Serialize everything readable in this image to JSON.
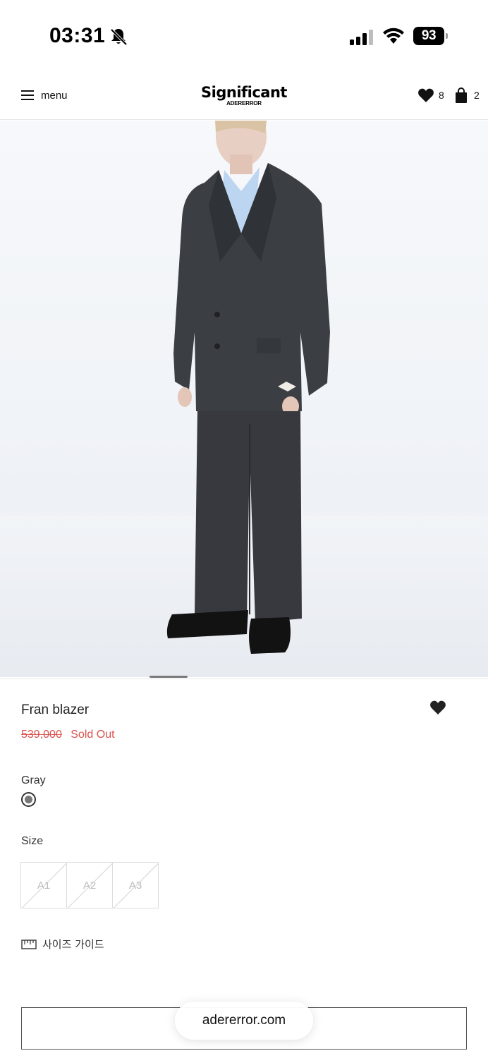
{
  "status_bar": {
    "time": "03:31",
    "battery": "93"
  },
  "header": {
    "menu_label": "menu",
    "logo_main": "Significant",
    "logo_sub": "ADERERROR",
    "wishlist_count": "8",
    "cart_count": "2"
  },
  "product": {
    "name": "Fran blazer",
    "original_price": "539,000",
    "status": "Sold Out",
    "status_color": "#d9534f",
    "color_label": "Gray",
    "size_label": "Size",
    "sizes": [
      "A1",
      "A2",
      "A3"
    ],
    "size_guide": "사이즈 가이드"
  },
  "browser": {
    "url": "adererror.com"
  }
}
